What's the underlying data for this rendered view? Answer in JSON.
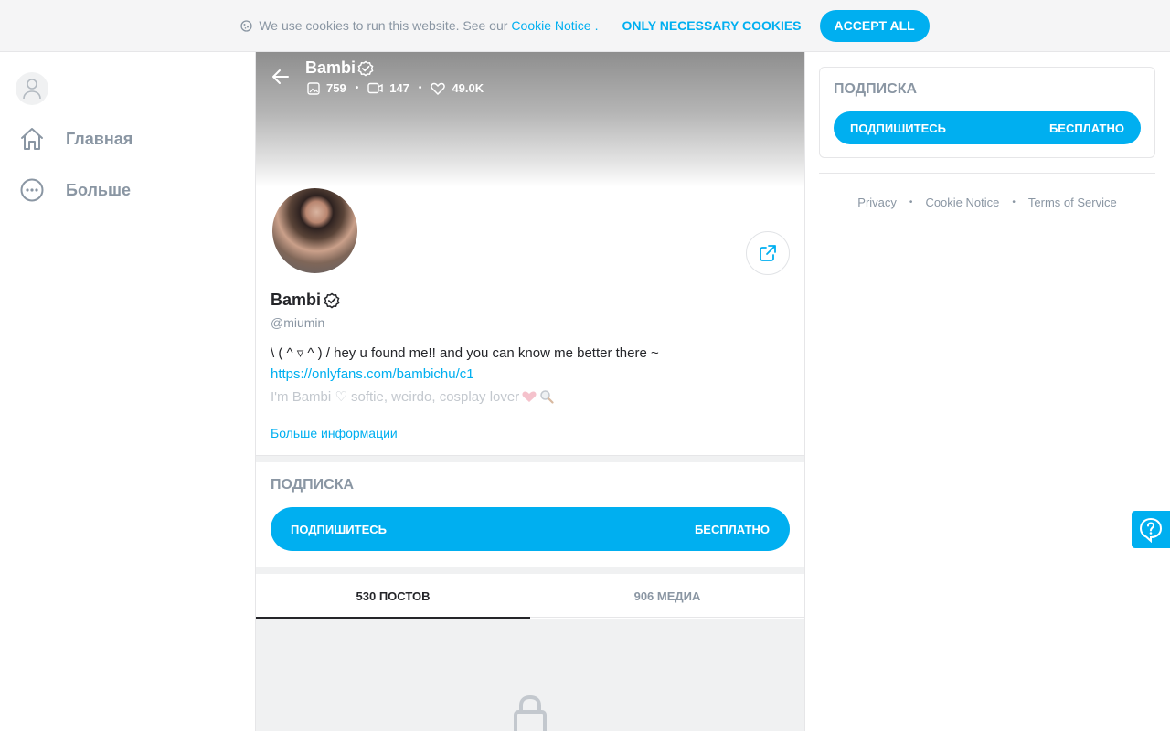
{
  "cookie_bar": {
    "text": "We use cookies to run this website. See our",
    "link": "Cookie Notice",
    "dot": ".",
    "necessary_label": "ONLY NECESSARY COOKIES",
    "accept_label": "ACCEPT ALL"
  },
  "sidebar": {
    "items": [
      {
        "label": "Главная",
        "icon": "home-icon"
      },
      {
        "label": "Больше",
        "icon": "more-icon"
      }
    ]
  },
  "profile": {
    "cover_name": "Bambi",
    "stats": {
      "photos": "759",
      "videos": "147",
      "likes": "49.0K"
    },
    "name": "Bambi",
    "handle": "@miumin",
    "bio_line1": "\\ ( ^ ▿ ^ ) /  hey u found me!! and you can know me better there ~",
    "bio_link": "https://onlyfans.com/bambichu/c1",
    "bio_line3": "I'm Bambi ♡ softie, weirdo, cosplay lover",
    "more_info": "Больше информации"
  },
  "subscription": {
    "title": "ПОДПИСКА",
    "button_label": "ПОДПИШИТЕСЬ",
    "button_price": "БЕСПЛАТНО"
  },
  "tabs": [
    {
      "label": "530 ПОСТОВ",
      "active": true
    },
    {
      "label": "906 МЕДИА",
      "active": false
    }
  ],
  "footer": {
    "links": [
      "Privacy",
      "Cookie Notice",
      "Terms of Service"
    ],
    "separator": "•"
  },
  "colors": {
    "accent": "#00aff0",
    "muted": "#8a96a3",
    "text": "#242529"
  }
}
